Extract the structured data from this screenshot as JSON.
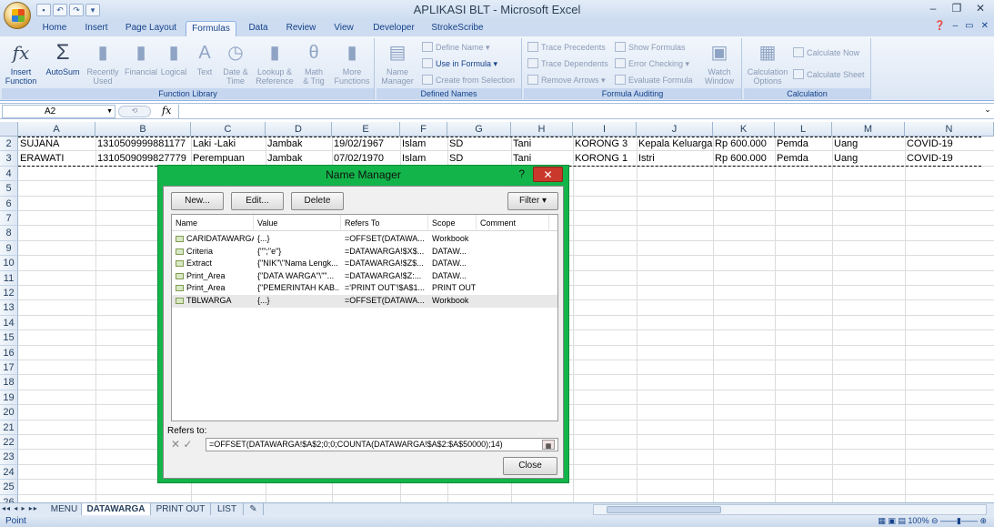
{
  "title": "APLIKASI BLT - Microsoft Excel",
  "ribbon_tabs": [
    "Home",
    "Insert",
    "Page Layout",
    "Formulas",
    "Data",
    "Review",
    "View",
    "Developer",
    "StrokeScribe"
  ],
  "active_tab": "Formulas",
  "ribbon": {
    "function_library": {
      "label": "Function Library",
      "insert_function": "Insert\nFunction",
      "autosum": "AutoSum",
      "recently_used": "Recently\nUsed",
      "financial": "Financial",
      "logical": "Logical",
      "text": "Text",
      "date_time": "Date &\nTime",
      "lookup_reference": "Lookup &\nReference",
      "math_trig": "Math\n& Trig",
      "more_functions": "More\nFunctions"
    },
    "defined_names": {
      "label": "Defined Names",
      "name_manager": "Name\nManager",
      "define_name": "Define Name",
      "use_in_formula": "Use in Formula",
      "create_from_selection": "Create from Selection"
    },
    "formula_auditing": {
      "label": "Formula Auditing",
      "trace_precedents": "Trace Precedents",
      "trace_dependents": "Trace Dependents",
      "remove_arrows": "Remove Arrows",
      "show_formulas": "Show Formulas",
      "error_checking": "Error Checking",
      "evaluate_formula": "Evaluate Formula",
      "watch_window": "Watch\nWindow"
    },
    "calculation": {
      "label": "Calculation",
      "calculation_options": "Calculation\nOptions",
      "calculate_now": "Calculate Now",
      "calculate_sheet": "Calculate Sheet"
    }
  },
  "formula_bar": {
    "name_box": "A2",
    "fx": "fx"
  },
  "columns": [
    "A",
    "B",
    "C",
    "D",
    "E",
    "F",
    "G",
    "H",
    "I",
    "J",
    "K",
    "L",
    "M",
    "N"
  ],
  "rows": [
    "2",
    "3",
    "4",
    "5",
    "6",
    "7",
    "8",
    "9",
    "10",
    "11",
    "12",
    "13",
    "14",
    "15",
    "16",
    "17",
    "18",
    "19",
    "20",
    "21",
    "22",
    "23",
    "24",
    "25",
    "26"
  ],
  "cells": {
    "row2": [
      "SUJANA",
      "1310509999881177",
      "Laki -Laki",
      "Jambak",
      "19/02/1967",
      "Islam",
      "SD",
      "Tani",
      "KORONG 3",
      "Kepala Keluarga",
      "Rp 600.000",
      "Pemda",
      "Uang",
      "COVID-19"
    ],
    "row3": [
      "ERAWATI",
      "1310509099827779",
      "Perempuan",
      "Jambak",
      "07/02/1970",
      "Islam",
      "SD",
      "Tani",
      "KORONG 1",
      "Istri",
      "Rp 600.000",
      "Pemda",
      "Uang",
      "COVID-19"
    ]
  },
  "sheet_tabs": [
    "MENU",
    "DATAWARGA",
    "PRINT OUT",
    "LIST"
  ],
  "active_sheet": "DATAWARGA",
  "status": "Point",
  "zoom": "100%",
  "dialog": {
    "title": "Name Manager",
    "help": "?",
    "close": "✕",
    "buttons": {
      "new": "New...",
      "edit": "Edit...",
      "delete": "Delete",
      "filter": "Filter"
    },
    "headers": [
      "Name",
      "Value",
      "Refers To",
      "Scope",
      "Comment"
    ],
    "names": [
      {
        "name": "CARIDATAWARGA",
        "value": "{...}",
        "refers_to": "=OFFSET(DATAWA...",
        "scope": "Workbook",
        "comment": ""
      },
      {
        "name": "Criteria",
        "value": "{\"\";\"e\"}",
        "refers_to": "=DATAWARGA!$X$...",
        "scope": "DATAW...",
        "comment": ""
      },
      {
        "name": "Extract",
        "value": "{\"NIK\"\\\"Nama Lengk...",
        "refers_to": "=DATAWARGA!$Z$...",
        "scope": "DATAW...",
        "comment": ""
      },
      {
        "name": "Print_Area",
        "value": "{\"DATA WARGA\"\\\"\"...",
        "refers_to": "=DATAWARGA!$Z:...",
        "scope": "DATAW...",
        "comment": ""
      },
      {
        "name": "Print_Area",
        "value": "{\"PEMERINTAH KAB...",
        "refers_to": "='PRINT OUT'!$A$1...",
        "scope": "PRINT OUT",
        "comment": ""
      },
      {
        "name": "TBLWARGA",
        "value": "{...}",
        "refers_to": "=OFFSET(DATAWA...",
        "scope": "Workbook",
        "comment": ""
      }
    ],
    "selected_index": 5,
    "refers_to_label": "Refers to:",
    "refers_to_value": "=OFFSET(DATAWARGA!$A$2;0;0;COUNTA(DATAWARGA!$A$2:$A$50000);14)",
    "close_button": "Close"
  }
}
